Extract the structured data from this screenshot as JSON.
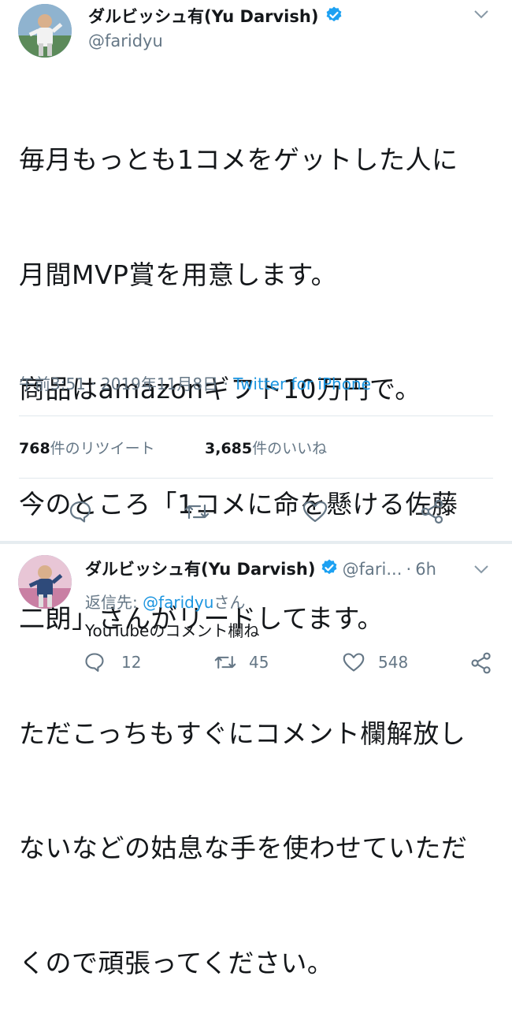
{
  "tweet": {
    "author_name": "ダルビッシュ有(Yu Darvish)",
    "author_handle": "@faridyu",
    "text_lines": [
      "毎月もっとも1コメをゲットした人に",
      "月間MVP賞を用意します。",
      "商品はamazonギフト10万円で。",
      "今のところ「1コメに命を懸ける佐藤",
      "二朗」さんがリードしてます。",
      "ただこっちもすぐにコメント欄解放し",
      "ないなどの姑息な手を使わせていただ",
      "くので頑張ってください。"
    ],
    "time": "午前3:51",
    "date": "2019年11月8日",
    "separator": "·",
    "source": "Twitter for iPhone",
    "retweets_count": "768",
    "retweets_label": "件のリツイート",
    "likes_count": "3,685",
    "likes_label": "件のいいね"
  },
  "reply": {
    "author_name": "ダルビッシュ有(Yu Darvish)",
    "author_handle": "@fari...",
    "dot": "·",
    "age": "6h",
    "reply_prefix": "返信先: ",
    "reply_mention": "@faridyu",
    "reply_suffix": "さん",
    "text": "YouTubeのコメント欄ね",
    "reply_count": "12",
    "retweet_count": "45",
    "like_count": "548"
  },
  "colors": {
    "link": "#1b95e0",
    "secondary": "#657786",
    "verified": "#1da1f2",
    "divider": "#e1e8ed"
  }
}
